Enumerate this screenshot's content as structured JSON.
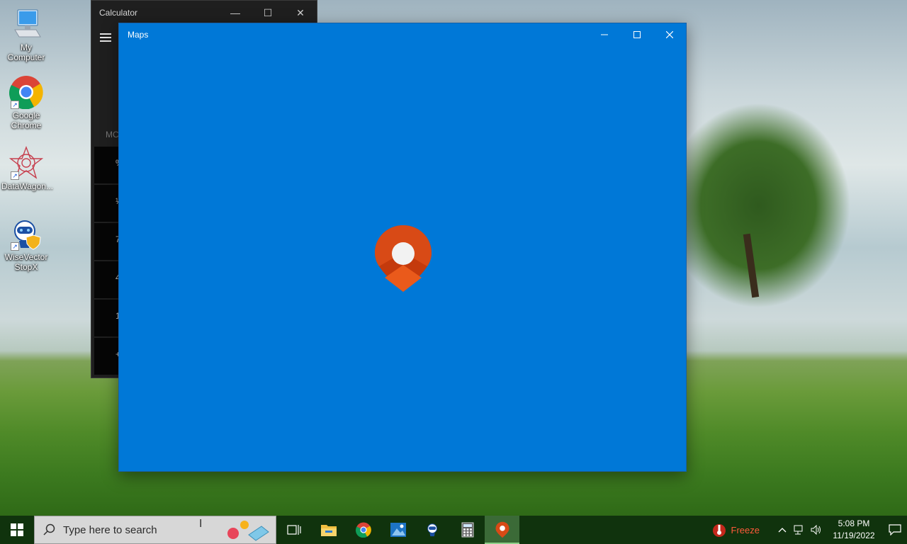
{
  "desktop": {
    "icons": [
      {
        "label": "My Computer",
        "icon": "computer-icon"
      },
      {
        "label": "Google Chrome",
        "icon": "chrome-icon"
      },
      {
        "label": "DataWagon...",
        "icon": "datawagon-icon"
      },
      {
        "label": "WiseVector StopX",
        "icon": "wisevector-icon"
      }
    ]
  },
  "calculator": {
    "title": "Calculator",
    "memory_label": "MC",
    "keys": [
      "%",
      "¹⁄",
      "7",
      "4",
      "1",
      "+"
    ]
  },
  "maps": {
    "title": "Maps",
    "accent": "#0078d7",
    "pin_color": "#d83b01"
  },
  "taskbar": {
    "search_placeholder": "Type here to search",
    "apps": [
      {
        "name": "task-view",
        "icon": "task-view-icon"
      },
      {
        "name": "file-explorer",
        "icon": "folder-icon"
      },
      {
        "name": "chrome",
        "icon": "chrome-icon"
      },
      {
        "name": "photos",
        "icon": "photos-icon"
      },
      {
        "name": "wisevector",
        "icon": "wisevector-icon"
      },
      {
        "name": "calculator",
        "icon": "calculator-icon"
      },
      {
        "name": "maps",
        "icon": "maps-pin-icon",
        "active": true
      }
    ],
    "weather_label": "Freeze",
    "time": "5:08 PM",
    "date": "11/19/2022"
  }
}
